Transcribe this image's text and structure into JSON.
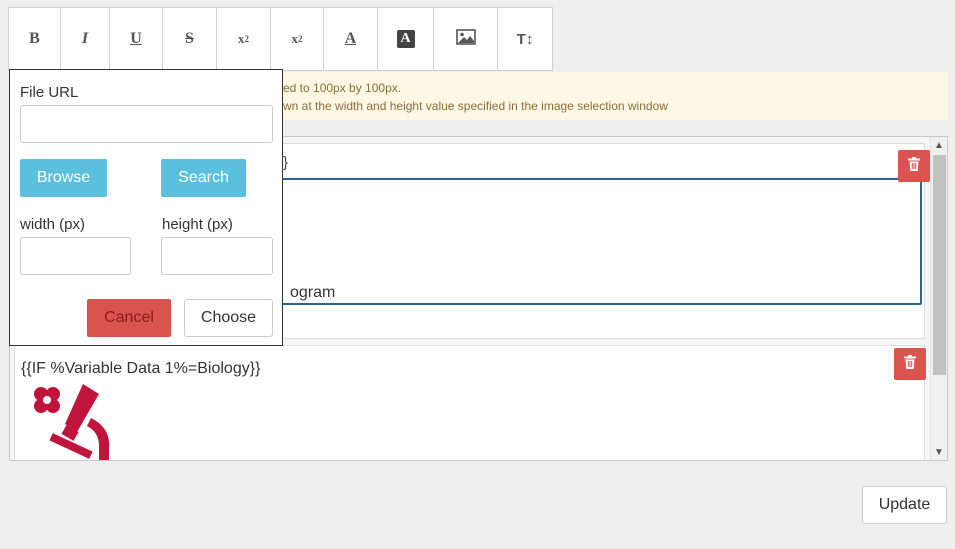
{
  "toolbar": {
    "bold": "B",
    "italic": "I",
    "underline": "U",
    "strike": "S",
    "superscript_base": "x",
    "superscript_exp": "2",
    "subscript_base": "x",
    "subscript_exp": "2",
    "font_color": "A",
    "bg_color": "A",
    "image_icon": "image-icon",
    "font_size": "T↕"
  },
  "notice": {
    "line1": "ed to 100px by 100px.",
    "line2": "wn at the width and height value specified in the image selection window"
  },
  "blocks": [
    {
      "partial_text": "}",
      "edit_line": "ogram"
    },
    {
      "condition": "{{IF %Variable Data 1%=Biology}}",
      "image_icon": "microscope-icon"
    }
  ],
  "popup": {
    "file_url_label": "File URL",
    "file_url_value": "",
    "browse_label": "Browse",
    "search_label": "Search",
    "width_label": "width (px)",
    "height_label": "height (px)",
    "width_value": "",
    "height_value": "",
    "cancel_label": "Cancel",
    "choose_label": "Choose"
  },
  "update_label": "Update",
  "colors": {
    "info": "#5bc0de",
    "danger": "#d9534f",
    "focus": "#2a6496",
    "warning_bg": "#fcf8e3",
    "warning_text": "#8a6d3b",
    "microscope": "#c0143c"
  }
}
